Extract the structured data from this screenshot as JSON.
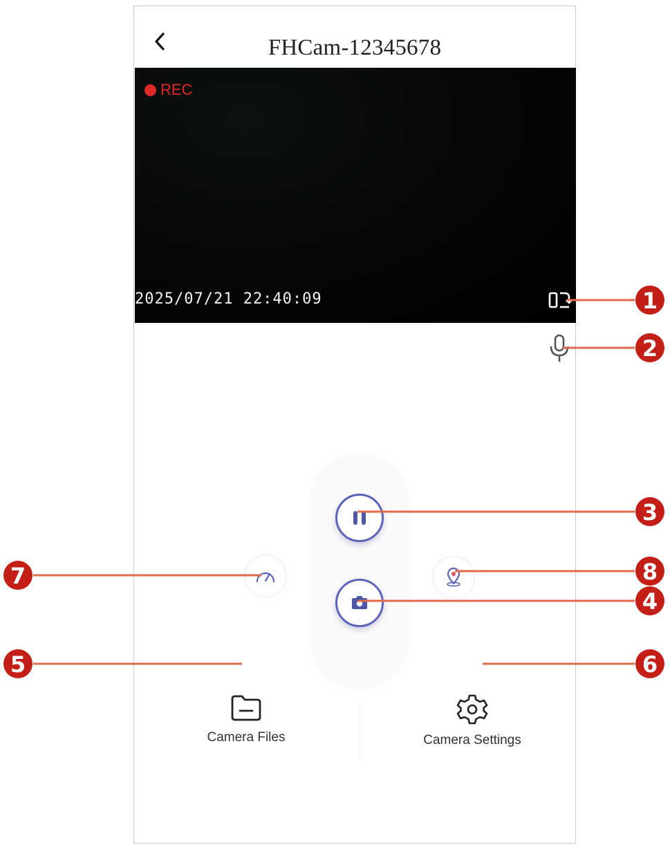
{
  "header": {
    "back_icon": "chevron-left-icon",
    "title": "FHCam-12345678"
  },
  "video": {
    "rec_label": "REC",
    "timestamp": "2025/07/21 22:40:09"
  },
  "controls": {
    "rotate_icon": "rotate-screen-icon",
    "mic_icon": "microphone-icon",
    "pause_icon": "pause-icon",
    "snapshot_icon": "camera-icon",
    "speed_icon": "speedometer-icon",
    "location_icon": "location-pin-icon"
  },
  "bottom_nav": {
    "files_label": "Camera Files",
    "settings_label": "Camera Settings"
  },
  "callouts": {
    "numbers": [
      "1",
      "2",
      "3",
      "4",
      "5",
      "6",
      "7",
      "8"
    ],
    "color": "#c41f16",
    "line_color": "#e06a4a"
  },
  "colors": {
    "accent": "#5a63b8",
    "rec": "#e02828"
  }
}
